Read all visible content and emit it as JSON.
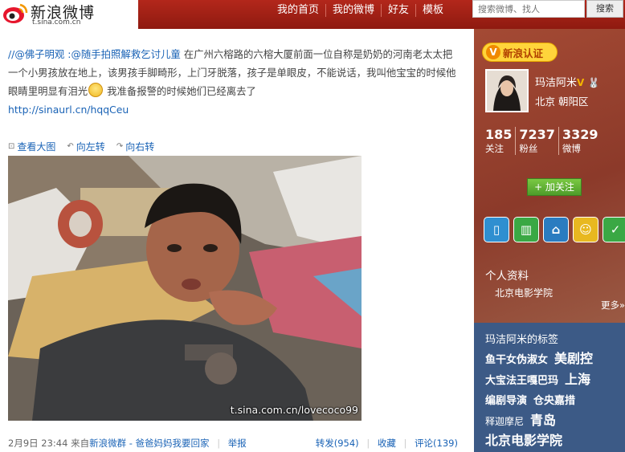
{
  "header": {
    "logo_text": "新浪微博",
    "logo_sub": "t.sina.com.cn",
    "nav": [
      "我的首页",
      "我的微博",
      "好友",
      "模板"
    ],
    "search_placeholder": "搜索微博、找人",
    "search_button": "搜索"
  },
  "post": {
    "user1": "//@佛子明观",
    "user2": ":@随手拍照解救乞讨儿童",
    "text1": "在广州六榕路的六榕大厦前面一位自称是奶奶的河南老太太把一个小男孩放在地上，该男孩手脚畸形，上门牙脱落，孩子是单眼皮，不能说话，我叫他宝宝的时候他眼睛里明显有泪光",
    "text2": "我准备报警的时候她们已经离去了",
    "url": "http://sinaurl.cn/hqqCeu",
    "tools": [
      "查看大图",
      "向左转",
      "向右转"
    ],
    "watermark": "t.sina.com.cn/lovecoco99",
    "time": "2月9日 23:44",
    "from_prefix": "来自",
    "source": "新浪微群 - 爸爸妈妈我要回家",
    "report": "举报",
    "repost": "转发(954)",
    "favorite": "收藏",
    "comment": "评论(139)"
  },
  "sidebar": {
    "verify_label": "新浪认证",
    "verify_icon": "V",
    "name": "玛洁阿米",
    "name_badge": "V",
    "name_rabbit": "🐰",
    "location": "北京  朝阳区",
    "stats": [
      {
        "num": "185",
        "label": "关注"
      },
      {
        "num": "7237",
        "label": "粉丝"
      },
      {
        "num": "3329",
        "label": "微博"
      }
    ],
    "follow_button": "+ 加关注",
    "apps": [
      {
        "icon": "phone-app-icon",
        "color": "#2f8fd0",
        "glyph": "▯"
      },
      {
        "icon": "book-app-icon",
        "color": "#3aa844",
        "glyph": "▥"
      },
      {
        "icon": "sofa-app-icon",
        "color": "#2a7cc0",
        "glyph": "⌂"
      },
      {
        "icon": "smile-app-icon",
        "color": "#e8b820",
        "glyph": "☺"
      },
      {
        "icon": "star-app-icon",
        "color": "#3aa844",
        "glyph": "✓"
      }
    ],
    "profile_title": "个人资料",
    "profile_value": "北京电影学院",
    "more": "更多»",
    "tags_title": "玛洁阿米的标签",
    "tags": [
      {
        "text": "鱼干女伪淑女",
        "size": "m"
      },
      {
        "text": "美剧控",
        "size": "l"
      },
      {
        "text": "大宝法王嘎巴玛",
        "size": "m"
      },
      {
        "text": "上海",
        "size": "l"
      },
      {
        "text": "编剧导演",
        "size": "m"
      },
      {
        "text": "仓央嘉措",
        "size": "m"
      },
      {
        "text": "释迦摩尼",
        "size": "s"
      },
      {
        "text": "青岛",
        "size": "l"
      },
      {
        "text": "北京电影学院",
        "size": "l"
      }
    ]
  }
}
